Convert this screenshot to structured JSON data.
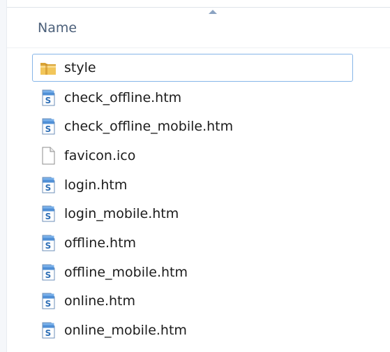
{
  "header": {
    "name_column_label": "Name"
  },
  "files": [
    {
      "name": "style",
      "icon": "folder-icon",
      "focused": true
    },
    {
      "name": "check_offline.htm",
      "icon": "html-document-icon"
    },
    {
      "name": "check_offline_mobile.htm",
      "icon": "html-document-icon"
    },
    {
      "name": "favicon.ico",
      "icon": "blank-file-icon"
    },
    {
      "name": "login.htm",
      "icon": "html-document-icon"
    },
    {
      "name": "login_mobile.htm",
      "icon": "html-document-icon"
    },
    {
      "name": "offline.htm",
      "icon": "html-document-icon"
    },
    {
      "name": "offline_mobile.htm",
      "icon": "html-document-icon"
    },
    {
      "name": "online.htm",
      "icon": "html-document-icon"
    },
    {
      "name": "online_mobile.htm",
      "icon": "html-document-icon"
    }
  ],
  "colors": {
    "folder": "#e8b84a",
    "html_icon_blue": "#3f7fc4",
    "selection_border": "#86b5e8"
  }
}
